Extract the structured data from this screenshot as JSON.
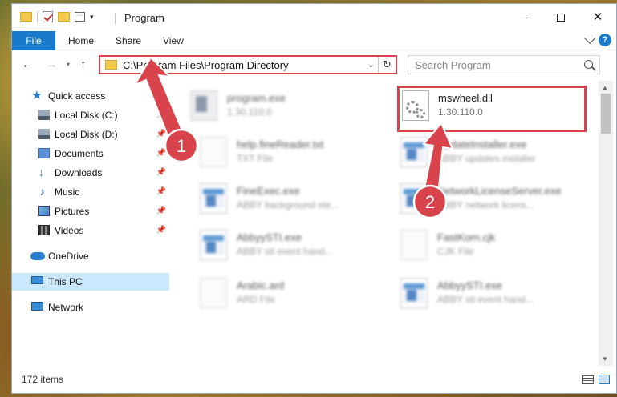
{
  "window": {
    "title": "Program",
    "minimize_icon": "minimize-icon",
    "maximize_icon": "maximize-icon",
    "close_glyph": "✕"
  },
  "ribbon": {
    "tabs": [
      "File",
      "Home",
      "Share",
      "View"
    ],
    "help_glyph": "?"
  },
  "nav": {
    "back_glyph": "←",
    "forward_glyph": "→",
    "recent_glyph": "▾",
    "up_glyph": "↑"
  },
  "address": {
    "path": "C:\\Program Files\\Program Directory",
    "dropdown_glyph": "⌄",
    "refresh_glyph": "↻"
  },
  "search": {
    "placeholder": "Search Program"
  },
  "sidebar": {
    "items": [
      {
        "label": "Quick access",
        "icon": "star-icon",
        "pinned": false
      },
      {
        "label": "Local Disk (C:)",
        "icon": "disk-icon",
        "pinned": true
      },
      {
        "label": "Local Disk (D:)",
        "icon": "disk-icon",
        "pinned": true
      },
      {
        "label": "Documents",
        "icon": "documents-icon",
        "pinned": true
      },
      {
        "label": "Downloads",
        "icon": "downloads-icon",
        "pinned": true
      },
      {
        "label": "Music",
        "icon": "music-icon",
        "pinned": true
      },
      {
        "label": "Pictures",
        "icon": "pictures-icon",
        "pinned": true
      },
      {
        "label": "Videos",
        "icon": "videos-icon",
        "pinned": true
      },
      {
        "label": "OneDrive",
        "icon": "onedrive-icon",
        "pinned": false
      },
      {
        "label": "This PC",
        "icon": "this-pc-icon",
        "pinned": false,
        "selected": true
      },
      {
        "label": "Network",
        "icon": "network-icon",
        "pinned": false
      }
    ],
    "pin_glyph": "📌"
  },
  "files": [
    {
      "name": "program.exe",
      "sub": "1.30.110.0",
      "icon": "app-icon",
      "blurred": true
    },
    {
      "name": "mswheel.dll",
      "sub": "1.30.110.0",
      "icon": "dll-gear-icon",
      "blurred": false,
      "highlighted": true
    },
    {
      "name": "help.fineReader.txt",
      "sub": "TXT File",
      "icon": "text-file-icon",
      "blurred": true
    },
    {
      "name": "UpdateInstaller.exe",
      "sub": "ABBY updates installer",
      "icon": "app-icon",
      "blurred": true
    },
    {
      "name": "FineExec.exe",
      "sub": "ABBY background ste...",
      "icon": "app-icon",
      "blurred": true
    },
    {
      "name": "NetworkLicenseServer.exe",
      "sub": "ABBY network licens...",
      "icon": "app-icon",
      "blurred": true
    },
    {
      "name": "AbbyySTI.exe",
      "sub": "ABBY sti event hand...",
      "icon": "app-icon",
      "blurred": true
    },
    {
      "name": "FastKorn.cjk",
      "sub": "CJK File",
      "icon": "blank-file-icon",
      "blurred": true
    },
    {
      "name": "Arabic.ard",
      "sub": "ARD File",
      "icon": "blank-file-icon",
      "blurred": true
    },
    {
      "name": "AbbyySTI.exe",
      "sub": "ABBY sti event hand...",
      "icon": "app-icon",
      "blurred": true
    }
  ],
  "status": {
    "item_count": "172 items"
  },
  "annotations": {
    "step1": "1",
    "step2": "2",
    "color": "#d9434c"
  }
}
